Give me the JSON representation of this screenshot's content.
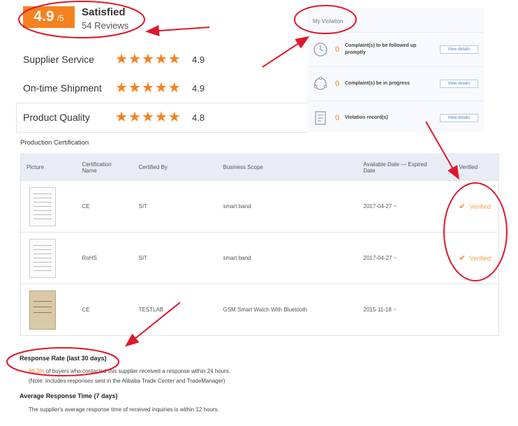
{
  "summary": {
    "score": "4.9",
    "score_denominator": "/5",
    "label": "Satisfied",
    "reviews": "54 Reviews"
  },
  "ratings": [
    {
      "label": "Supplier Service",
      "value": "4.9",
      "stars": 5
    },
    {
      "label": "On-time Shipment",
      "value": "4.9",
      "stars": 5
    },
    {
      "label": "Product Quality",
      "value": "4.8",
      "stars": 5
    }
  ],
  "violation": {
    "title": "My Violation",
    "items": [
      {
        "count": "0",
        "text": "Complaint(s) to be followed up promptly",
        "button": "View details",
        "icon": "clock-icon"
      },
      {
        "count": "0",
        "text": "Complaint(s) be in progress",
        "button": "View details",
        "icon": "cycle-icon"
      },
      {
        "count": "0",
        "text": "Violation record(s)",
        "button": "View details",
        "icon": "document-icon"
      }
    ]
  },
  "certification": {
    "title": "Production Certification",
    "headers": [
      "Picture",
      "Certification Name",
      "Certified By",
      "Business Scope",
      "Available Date — Expired Date",
      "Verified"
    ],
    "rows": [
      {
        "name": "CE",
        "by": "SIT",
        "scope": "smart band",
        "date": "2017-04-27 ~",
        "verified": "Verified"
      },
      {
        "name": "RoHS",
        "by": "SIT",
        "scope": "smart band",
        "date": "2017-04-27 ~",
        "verified": "Verified"
      },
      {
        "name": "CE",
        "by": "TESTLAB",
        "scope": "GSM Smart Watch With Bluetooth",
        "date": "2015-11-18 ~",
        "verified": ""
      }
    ]
  },
  "response": {
    "title": "Response Rate (last 30 days)",
    "rate": "96.3%",
    "rate_text": " of buyers who contacted this supplier received a response within 24 hours.",
    "note": "(Note: includes responses sent in the Alibaba Trade Center and TradeManager)",
    "avg_title": "Average Response Time (7 days)",
    "avg_text": "The supplier's average response time of received inquiries is within 12 hours."
  },
  "colors": {
    "accent": "#f5821f",
    "annotation": "#e0162b"
  }
}
